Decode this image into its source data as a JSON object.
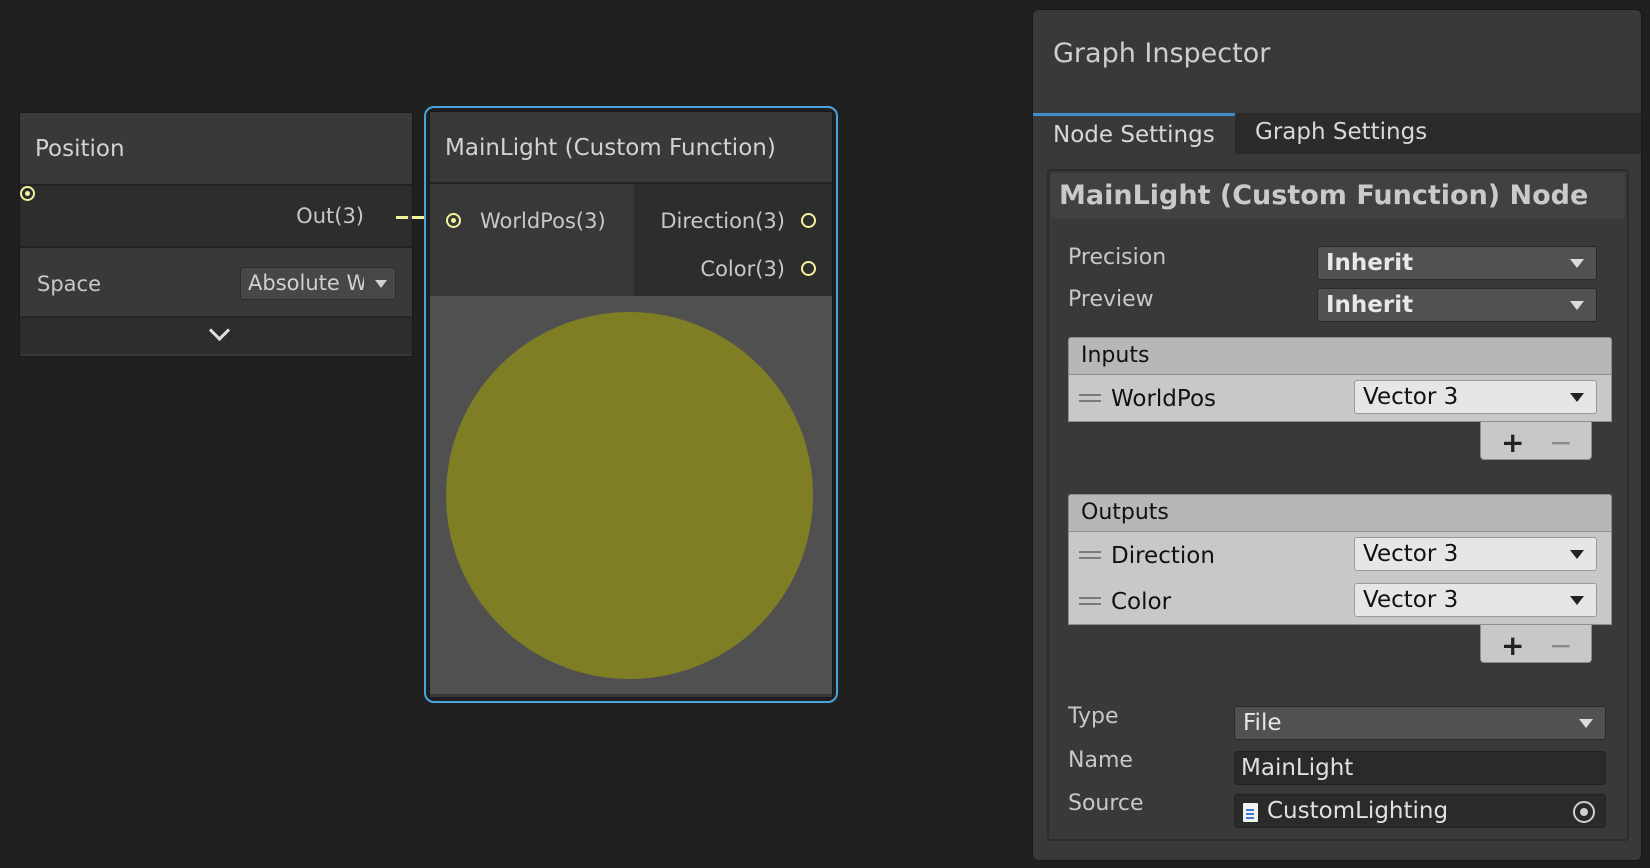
{
  "colors": {
    "port": "#f2f29c",
    "selection_outline": "#4aa3df",
    "preview_sphere": "#807e25",
    "preview_bg": "#505050",
    "active_tab_accent": "#3c8ecf"
  },
  "position_node": {
    "title": "Position",
    "output_label": "Out(3)",
    "space_label": "Space",
    "space_value": "Absolute World"
  },
  "mainlight_node": {
    "title": "MainLight (Custom Function)",
    "input_label": "WorldPos(3)",
    "output_direction_label": "Direction(3)",
    "output_color_label": "Color(3)"
  },
  "inspector": {
    "title": "Graph Inspector",
    "tabs": [
      "Node Settings",
      "Graph Settings"
    ],
    "active_tab": "Node Settings",
    "node_heading": "MainLight (Custom Function) Node",
    "precision_label": "Precision",
    "precision_value": "Inherit",
    "preview_label": "Preview",
    "preview_value": "Inherit",
    "inputs": {
      "header": "Inputs",
      "items": [
        {
          "name": "WorldPos",
          "type": "Vector 3"
        }
      ]
    },
    "outputs": {
      "header": "Outputs",
      "items": [
        {
          "name": "Direction",
          "type": "Vector 3"
        },
        {
          "name": "Color",
          "type": "Vector 3"
        }
      ]
    },
    "list_buttons": {
      "add": "+",
      "remove": "−"
    },
    "type_label": "Type",
    "type_value": "File",
    "name_label": "Name",
    "name_value": "MainLight",
    "source_label": "Source",
    "source_value": "CustomLighting"
  }
}
